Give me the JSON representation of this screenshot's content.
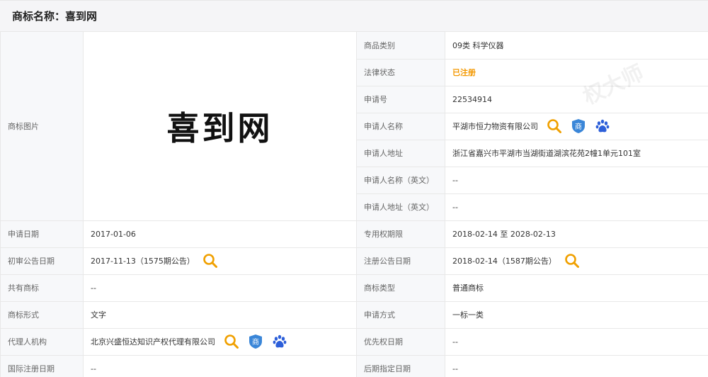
{
  "header": {
    "title": "商标名称：喜到网"
  },
  "trademark_image_text": "喜到网",
  "watermark_text": "权大师",
  "rows": {
    "image_label": "商标图片",
    "goods_class_label": "商品类别",
    "goods_class_value": "09类 科学仪器",
    "legal_status_label": "法律状态",
    "legal_status_value": "已注册",
    "app_no_label": "申请号",
    "app_no_value": "22534914",
    "applicant_label": "申请人名称",
    "applicant_value": "平湖市恒力物资有限公司",
    "applicant_addr_label": "申请人地址",
    "applicant_addr_value": "浙江省嘉兴市平湖市当湖街道湖滨花苑2幢1单元101室",
    "applicant_en_label": "申请人名称（英文）",
    "applicant_en_value": "--",
    "applicant_addr_en_label": "申请人地址（英文）",
    "applicant_addr_en_value": "--",
    "app_date_label": "申请日期",
    "app_date_value": "2017-01-06",
    "exclusive_label": "专用权期限",
    "exclusive_value": "2018-02-14 至 2028-02-13",
    "prelim_label": "初审公告日期",
    "prelim_value": "2017-11-13（1575期公告）",
    "reg_pub_label": "注册公告日期",
    "reg_pub_value": "2018-02-14（1587期公告）",
    "shared_label": "共有商标",
    "shared_value": "--",
    "type_label": "商标类型",
    "type_value": "普通商标",
    "form_label": "商标形式",
    "form_value": "文字",
    "apply_method_label": "申请方式",
    "apply_method_value": "一标一类",
    "agent_label": "代理人机构",
    "agent_value": "北京兴盛恒达知识产权代理有限公司",
    "priority_label": "优先权日期",
    "priority_value": "--",
    "intl_label": "国际注册日期",
    "intl_value": "--",
    "later_label": "后期指定日期",
    "later_value": "--"
  },
  "icons": {
    "search": "search-icon",
    "shang": "商",
    "baidu": "baidu-paw-icon"
  },
  "colors": {
    "search": "#f0a000",
    "shield": "#3a86d8",
    "baidu": "#2d5fd9",
    "status": "#f39800"
  }
}
